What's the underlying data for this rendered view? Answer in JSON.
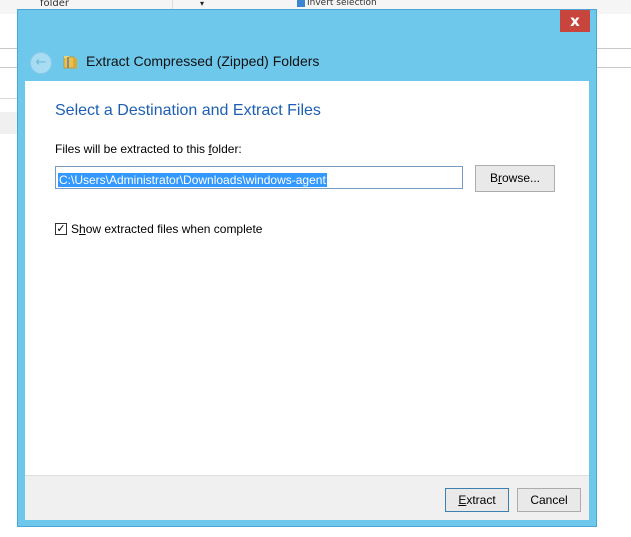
{
  "background": {
    "folder_label": "folder",
    "dropdown_caret": "▾",
    "invert_label": "Invert selection"
  },
  "dialog": {
    "close_label": "x",
    "back_glyph": "←",
    "title": "Extract Compressed (Zipped) Folders",
    "heading": "Select a Destination and Extract Files",
    "path_label": {
      "before": "Files will be extracted to this ",
      "accel": "f",
      "after": "older:"
    },
    "path_value": "C:\\Users\\Administrator\\Downloads\\windows-agent",
    "browse": {
      "before": "B",
      "accel": "r",
      "after": "owse..."
    },
    "show_checkbox": {
      "checked": true,
      "mark": "✓",
      "before": "S",
      "accel": "h",
      "after": "ow extracted files when complete"
    },
    "extract": {
      "before": "",
      "accel": "E",
      "after": "xtract"
    },
    "cancel": "Cancel"
  },
  "colors": {
    "frame": "#6ec8ec",
    "heading": "#1e5fb3",
    "selection": "#3399ff",
    "close": "#c7453c"
  }
}
